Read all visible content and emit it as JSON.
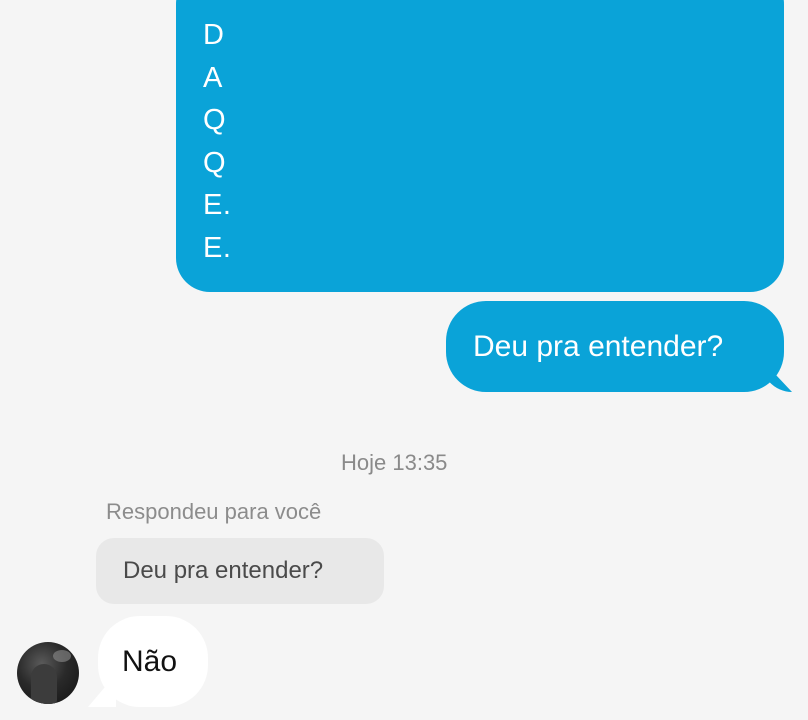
{
  "colors": {
    "background": "#f5f5f5",
    "outgoing_bubble": "#0aa3d8",
    "incoming_bubble": "#ffffff",
    "reply_preview_bg": "#e8e8e8",
    "meta_text": "#8a8a8a"
  },
  "messages": {
    "outgoing_letters": [
      "D",
      "A",
      "Q",
      "Q",
      "E.",
      "E."
    ],
    "outgoing_question": "Deu pra entender?",
    "timestamp": "Hoje 13:35",
    "reply": {
      "label": "Respondeu para você",
      "quoted_text": "Deu pra entender?"
    },
    "incoming_text": "Não",
    "incoming_avatar_icon": "user-avatar"
  }
}
